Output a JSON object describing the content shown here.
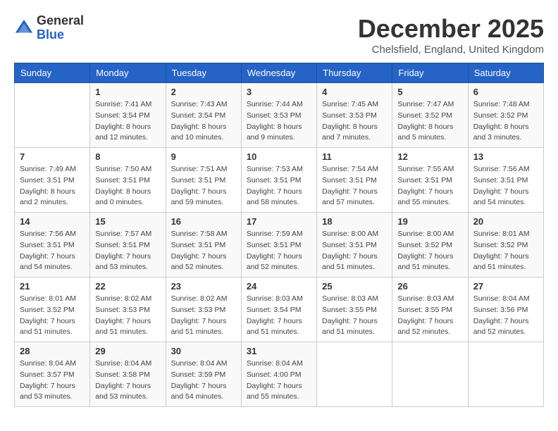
{
  "header": {
    "logo": {
      "general": "General",
      "blue": "Blue"
    },
    "title": "December 2025",
    "location": "Chelsfield, England, United Kingdom"
  },
  "days_of_week": [
    "Sunday",
    "Monday",
    "Tuesday",
    "Wednesday",
    "Thursday",
    "Friday",
    "Saturday"
  ],
  "weeks": [
    [
      {
        "day": "",
        "info": ""
      },
      {
        "day": "1",
        "sunrise": "Sunrise: 7:41 AM",
        "sunset": "Sunset: 3:54 PM",
        "daylight": "Daylight: 8 hours and 12 minutes."
      },
      {
        "day": "2",
        "sunrise": "Sunrise: 7:43 AM",
        "sunset": "Sunset: 3:54 PM",
        "daylight": "Daylight: 8 hours and 10 minutes."
      },
      {
        "day": "3",
        "sunrise": "Sunrise: 7:44 AM",
        "sunset": "Sunset: 3:53 PM",
        "daylight": "Daylight: 8 hours and 9 minutes."
      },
      {
        "day": "4",
        "sunrise": "Sunrise: 7:45 AM",
        "sunset": "Sunset: 3:53 PM",
        "daylight": "Daylight: 8 hours and 7 minutes."
      },
      {
        "day": "5",
        "sunrise": "Sunrise: 7:47 AM",
        "sunset": "Sunset: 3:52 PM",
        "daylight": "Daylight: 8 hours and 5 minutes."
      },
      {
        "day": "6",
        "sunrise": "Sunrise: 7:48 AM",
        "sunset": "Sunset: 3:52 PM",
        "daylight": "Daylight: 8 hours and 3 minutes."
      }
    ],
    [
      {
        "day": "7",
        "sunrise": "Sunrise: 7:49 AM",
        "sunset": "Sunset: 3:51 PM",
        "daylight": "Daylight: 8 hours and 2 minutes."
      },
      {
        "day": "8",
        "sunrise": "Sunrise: 7:50 AM",
        "sunset": "Sunset: 3:51 PM",
        "daylight": "Daylight: 8 hours and 0 minutes."
      },
      {
        "day": "9",
        "sunrise": "Sunrise: 7:51 AM",
        "sunset": "Sunset: 3:51 PM",
        "daylight": "Daylight: 7 hours and 59 minutes."
      },
      {
        "day": "10",
        "sunrise": "Sunrise: 7:53 AM",
        "sunset": "Sunset: 3:51 PM",
        "daylight": "Daylight: 7 hours and 58 minutes."
      },
      {
        "day": "11",
        "sunrise": "Sunrise: 7:54 AM",
        "sunset": "Sunset: 3:51 PM",
        "daylight": "Daylight: 7 hours and 57 minutes."
      },
      {
        "day": "12",
        "sunrise": "Sunrise: 7:55 AM",
        "sunset": "Sunset: 3:51 PM",
        "daylight": "Daylight: 7 hours and 55 minutes."
      },
      {
        "day": "13",
        "sunrise": "Sunrise: 7:56 AM",
        "sunset": "Sunset: 3:51 PM",
        "daylight": "Daylight: 7 hours and 54 minutes."
      }
    ],
    [
      {
        "day": "14",
        "sunrise": "Sunrise: 7:56 AM",
        "sunset": "Sunset: 3:51 PM",
        "daylight": "Daylight: 7 hours and 54 minutes."
      },
      {
        "day": "15",
        "sunrise": "Sunrise: 7:57 AM",
        "sunset": "Sunset: 3:51 PM",
        "daylight": "Daylight: 7 hours and 53 minutes."
      },
      {
        "day": "16",
        "sunrise": "Sunrise: 7:58 AM",
        "sunset": "Sunset: 3:51 PM",
        "daylight": "Daylight: 7 hours and 52 minutes."
      },
      {
        "day": "17",
        "sunrise": "Sunrise: 7:59 AM",
        "sunset": "Sunset: 3:51 PM",
        "daylight": "Daylight: 7 hours and 52 minutes."
      },
      {
        "day": "18",
        "sunrise": "Sunrise: 8:00 AM",
        "sunset": "Sunset: 3:51 PM",
        "daylight": "Daylight: 7 hours and 51 minutes."
      },
      {
        "day": "19",
        "sunrise": "Sunrise: 8:00 AM",
        "sunset": "Sunset: 3:52 PM",
        "daylight": "Daylight: 7 hours and 51 minutes."
      },
      {
        "day": "20",
        "sunrise": "Sunrise: 8:01 AM",
        "sunset": "Sunset: 3:52 PM",
        "daylight": "Daylight: 7 hours and 51 minutes."
      }
    ],
    [
      {
        "day": "21",
        "sunrise": "Sunrise: 8:01 AM",
        "sunset": "Sunset: 3:52 PM",
        "daylight": "Daylight: 7 hours and 51 minutes."
      },
      {
        "day": "22",
        "sunrise": "Sunrise: 8:02 AM",
        "sunset": "Sunset: 3:53 PM",
        "daylight": "Daylight: 7 hours and 51 minutes."
      },
      {
        "day": "23",
        "sunrise": "Sunrise: 8:02 AM",
        "sunset": "Sunset: 3:53 PM",
        "daylight": "Daylight: 7 hours and 51 minutes."
      },
      {
        "day": "24",
        "sunrise": "Sunrise: 8:03 AM",
        "sunset": "Sunset: 3:54 PM",
        "daylight": "Daylight: 7 hours and 51 minutes."
      },
      {
        "day": "25",
        "sunrise": "Sunrise: 8:03 AM",
        "sunset": "Sunset: 3:55 PM",
        "daylight": "Daylight: 7 hours and 51 minutes."
      },
      {
        "day": "26",
        "sunrise": "Sunrise: 8:03 AM",
        "sunset": "Sunset: 3:55 PM",
        "daylight": "Daylight: 7 hours and 52 minutes."
      },
      {
        "day": "27",
        "sunrise": "Sunrise: 8:04 AM",
        "sunset": "Sunset: 3:56 PM",
        "daylight": "Daylight: 7 hours and 52 minutes."
      }
    ],
    [
      {
        "day": "28",
        "sunrise": "Sunrise: 8:04 AM",
        "sunset": "Sunset: 3:57 PM",
        "daylight": "Daylight: 7 hours and 53 minutes."
      },
      {
        "day": "29",
        "sunrise": "Sunrise: 8:04 AM",
        "sunset": "Sunset: 3:58 PM",
        "daylight": "Daylight: 7 hours and 53 minutes."
      },
      {
        "day": "30",
        "sunrise": "Sunrise: 8:04 AM",
        "sunset": "Sunset: 3:59 PM",
        "daylight": "Daylight: 7 hours and 54 minutes."
      },
      {
        "day": "31",
        "sunrise": "Sunrise: 8:04 AM",
        "sunset": "Sunset: 4:00 PM",
        "daylight": "Daylight: 7 hours and 55 minutes."
      },
      {
        "day": "",
        "info": ""
      },
      {
        "day": "",
        "info": ""
      },
      {
        "day": "",
        "info": ""
      }
    ]
  ]
}
